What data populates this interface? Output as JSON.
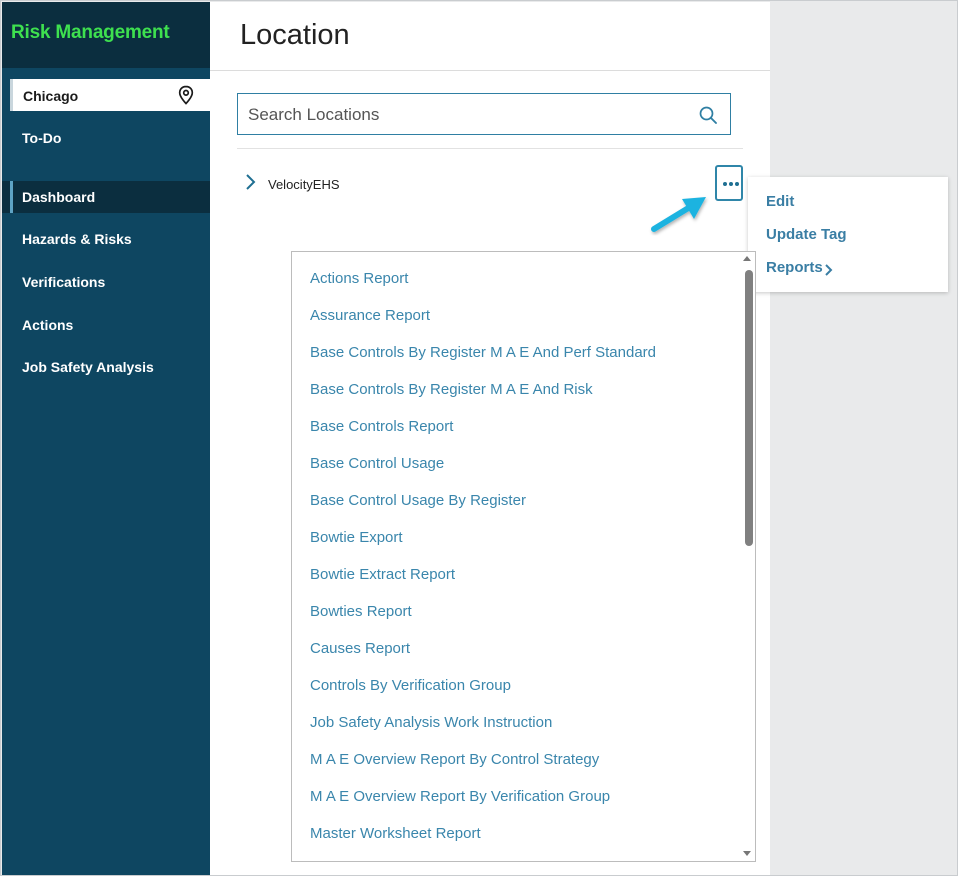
{
  "sidebar": {
    "brand": "Risk Management",
    "location": "Chicago",
    "location_icon": "map-pin-icon",
    "items": [
      {
        "label": "To-Do",
        "active": false
      },
      {
        "label": "Dashboard",
        "active": true
      },
      {
        "label": "Hazards & Risks",
        "active": false
      },
      {
        "label": "Verifications",
        "active": false
      },
      {
        "label": "Actions",
        "active": false
      },
      {
        "label": "Job Safety Analysis",
        "active": false
      }
    ]
  },
  "main": {
    "title": "Location",
    "search": {
      "placeholder": "Search Locations",
      "value": "",
      "icon": "search-icon"
    },
    "tree": [
      {
        "label": "VelocityEHS",
        "expanded": false
      }
    ],
    "more_icon": "more-horizontal-icon"
  },
  "context_menu": {
    "items": [
      "Edit",
      "Update Tag",
      "Reports"
    ]
  },
  "reports_menu": {
    "items": [
      "Actions Report",
      "Assurance Report",
      "Base Controls By Register M A E And Perf Standard",
      "Base Controls By Register M A E And Risk",
      "Base Controls Report",
      "Base Control Usage",
      "Base Control Usage By Register",
      "Bowtie Export",
      "Bowtie Extract Report",
      "Bowties Report",
      "Causes Report",
      "Controls By Verification Group",
      "Job Safety Analysis Work Instruction",
      "M A E Overview Report By Control Strategy",
      "M A E Overview Report By Verification Group",
      "Master Worksheet Report"
    ]
  },
  "colors": {
    "sidebar_bg": "#0e4661",
    "brand_bg": "#0b2e3f",
    "brand_text": "#3ee04f",
    "link": "#3a86ac",
    "accent": "#2f86a9",
    "arrow": "#1fb3e0"
  }
}
